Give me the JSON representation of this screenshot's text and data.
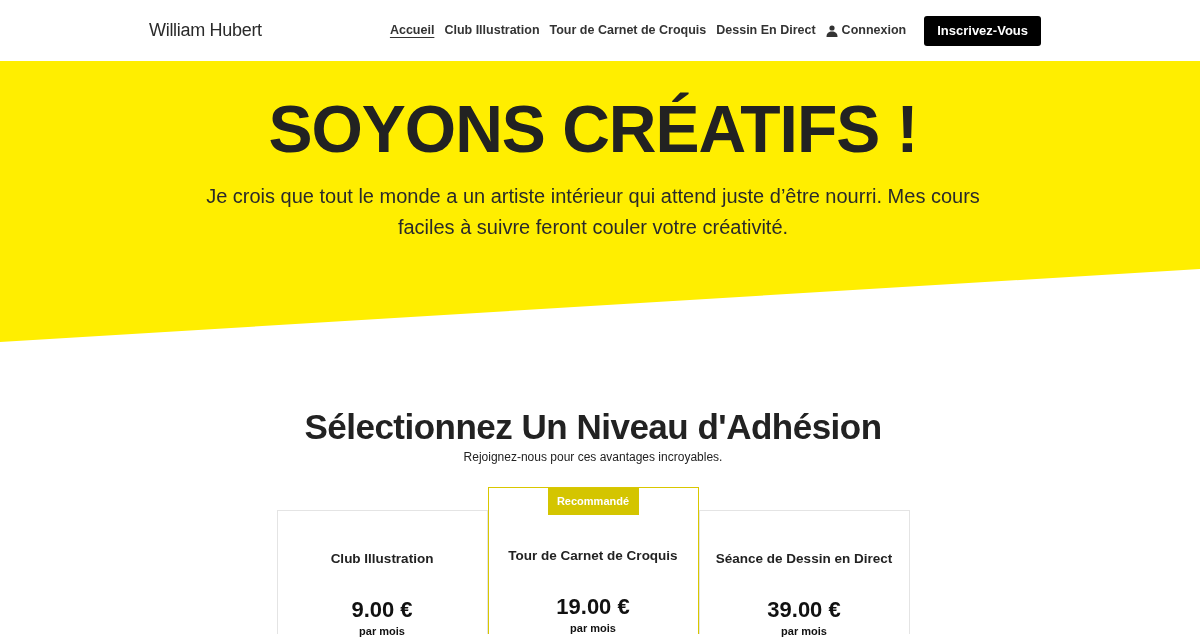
{
  "header": {
    "logo": "William Hubert",
    "nav": [
      {
        "label": "Accueil",
        "selected": true
      },
      {
        "label": "Club Illustration",
        "selected": false
      },
      {
        "label": "Tour de Carnet de Croquis",
        "selected": false
      },
      {
        "label": "Dessin En Direct",
        "selected": false
      }
    ],
    "login": "Connexion",
    "signup_button": "Inscrivez-Vous"
  },
  "hero": {
    "title": "SOYONS CRÉATIFS !",
    "text": "Je crois que tout le monde a un artiste intérieur qui attend juste d’être nourri. Mes cours faciles à suivre feront couler votre créativité."
  },
  "membership": {
    "title": "Sélectionnez Un Niveau d'Adhésion",
    "subtitle": "Rejoignez-nous pour ces avantages incroyables.",
    "plans": [
      {
        "name": "Club Illustration",
        "price": "9.00 €",
        "period": "par mois",
        "recommended": false
      },
      {
        "name": "Tour de Carnet de Croquis",
        "price": "19.00 €",
        "period": "par mois",
        "recommended": true,
        "badge": "Recommandé"
      },
      {
        "name": "Séance de Dessin en Direct",
        "price": "39.00 €",
        "period": "par mois",
        "recommended": false
      }
    ]
  }
}
